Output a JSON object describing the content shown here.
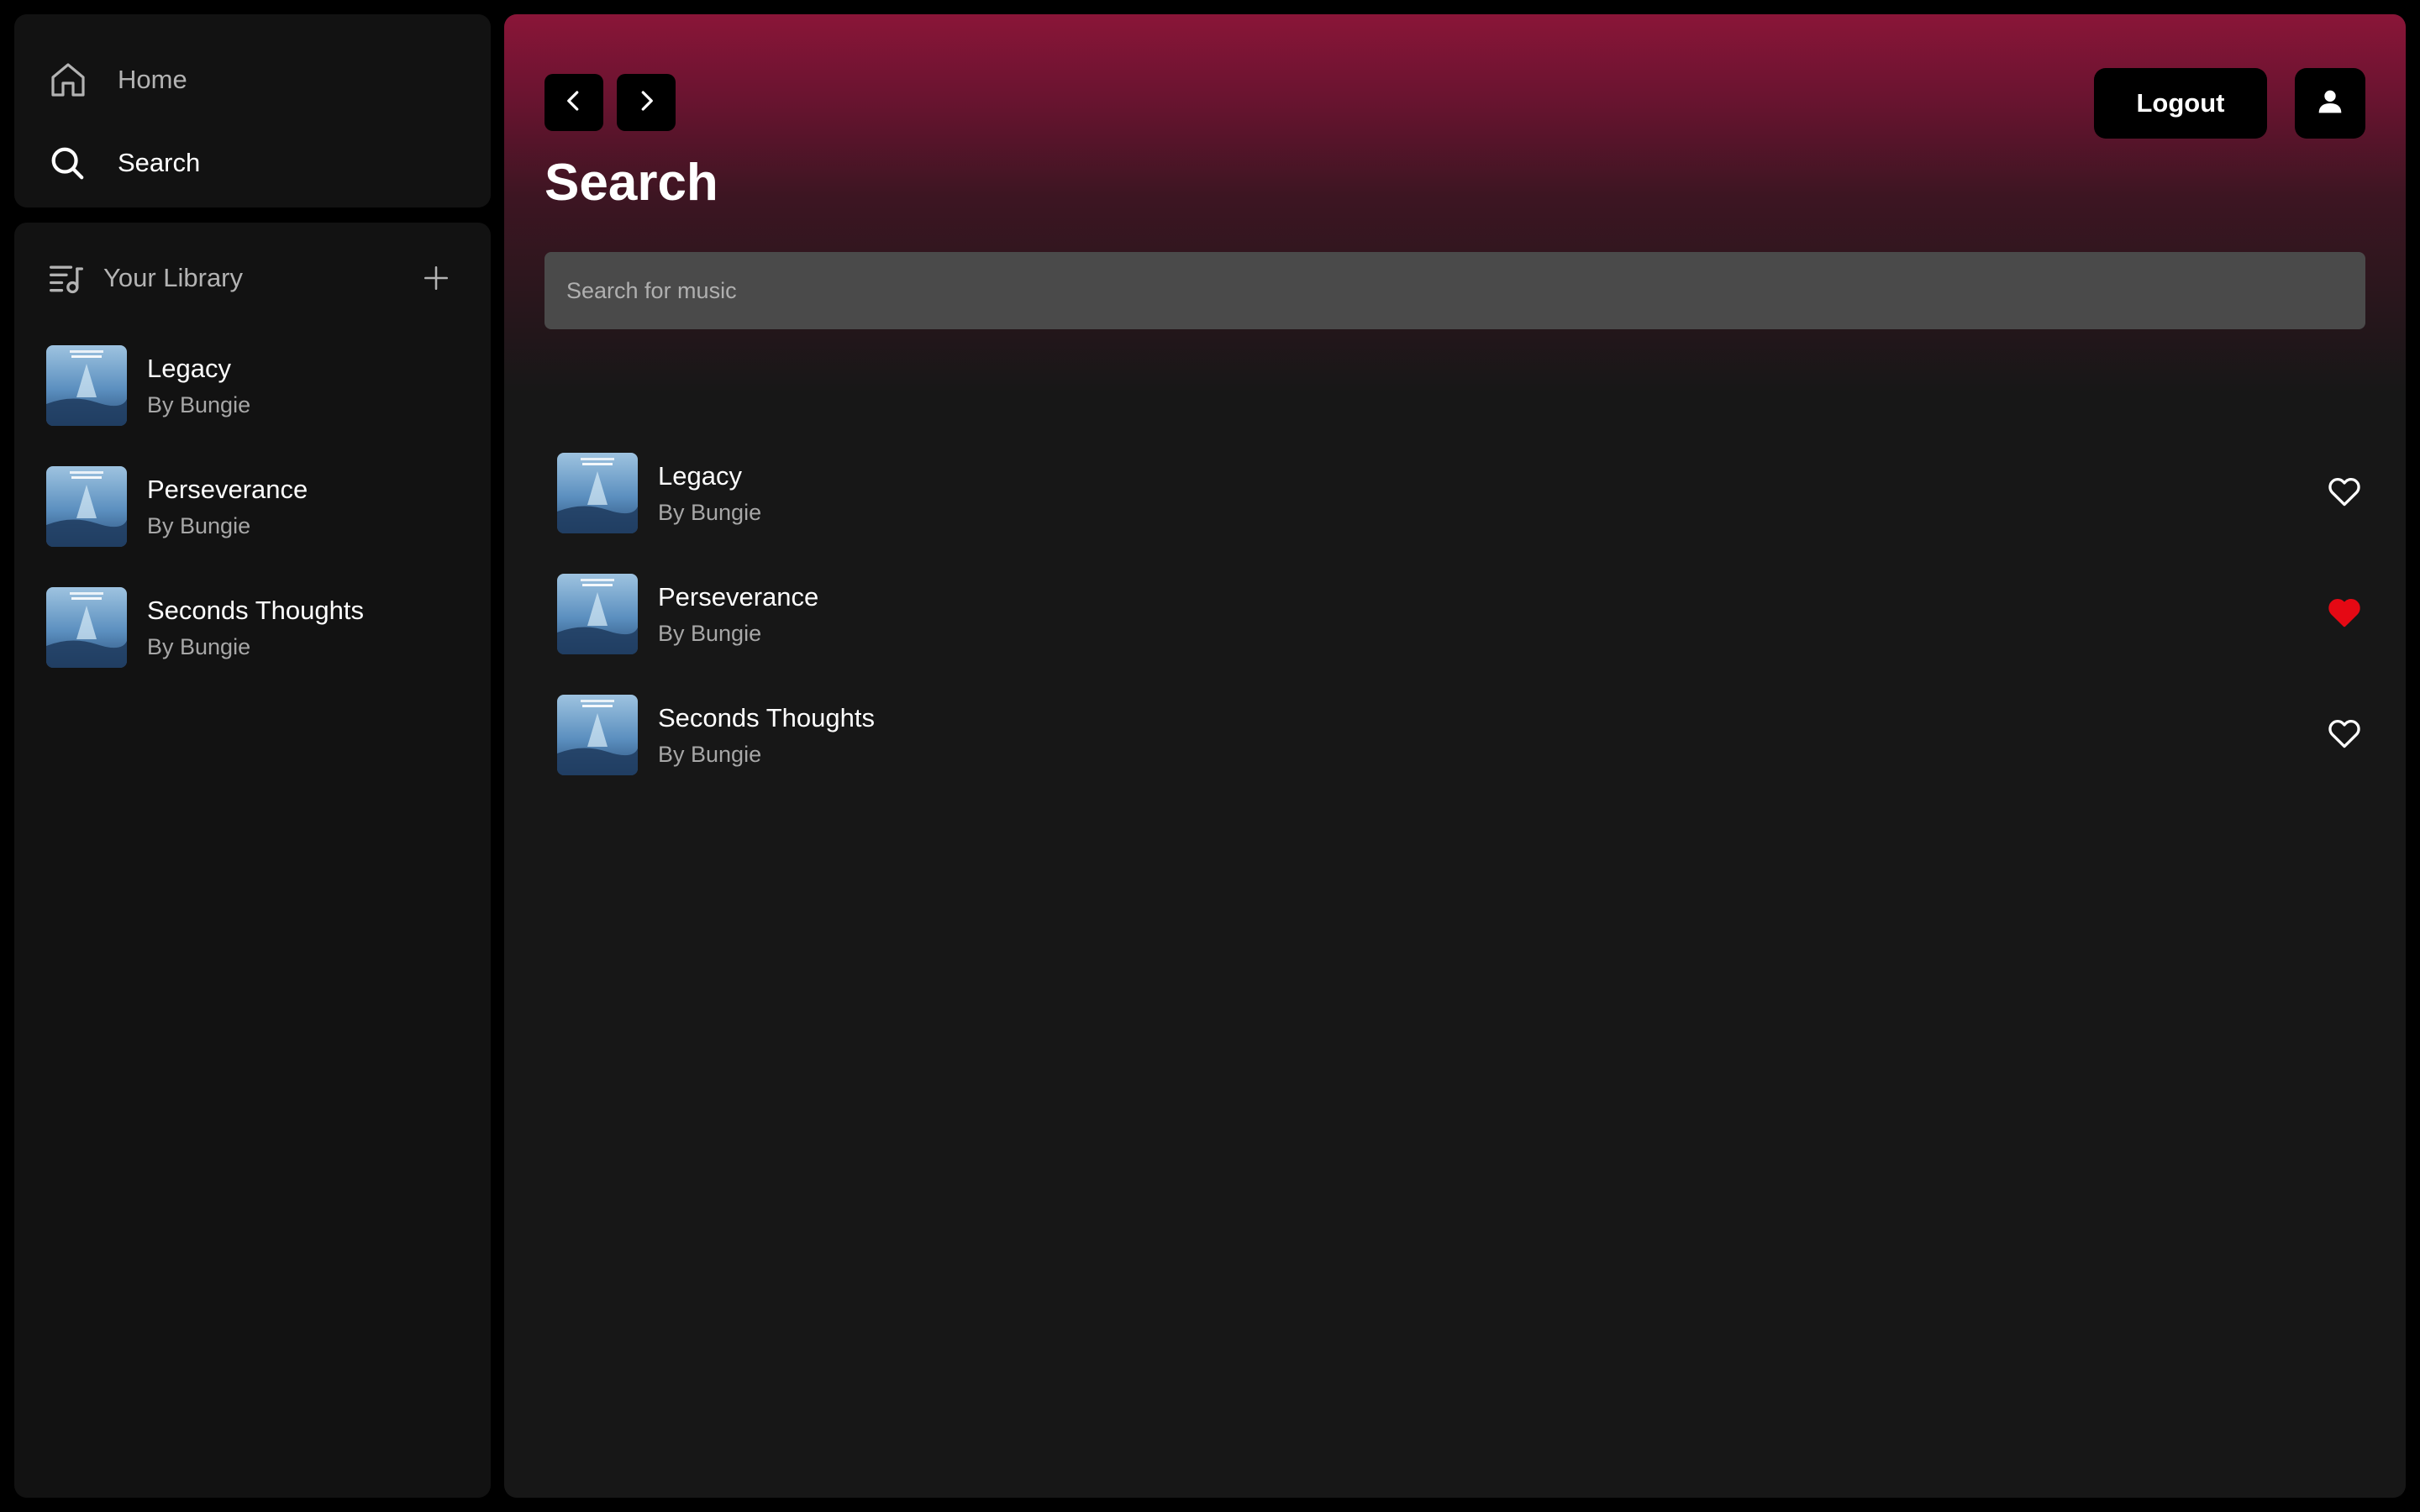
{
  "nav": {
    "home_label": "Home",
    "search_label": "Search"
  },
  "library": {
    "title": "Your Library",
    "items": [
      {
        "title": "Legacy",
        "artist": "By Bungie"
      },
      {
        "title": "Perseverance",
        "artist": "By Bungie"
      },
      {
        "title": "Seconds Thoughts",
        "artist": "By Bungie"
      }
    ]
  },
  "header": {
    "logout_label": "Logout"
  },
  "page": {
    "title": "Search"
  },
  "search": {
    "placeholder": "Search for music",
    "value": ""
  },
  "results": [
    {
      "title": "Legacy",
      "artist": "By Bungie",
      "liked": false
    },
    {
      "title": "Perseverance",
      "artist": "By Bungie",
      "liked": true
    },
    {
      "title": "Seconds Thoughts",
      "artist": "By Bungie",
      "liked": false
    }
  ],
  "colors": {
    "accent_gradient_top": "#8a1538",
    "liked_heart": "#e50914",
    "panel_bg": "#121212",
    "main_bg": "#171717"
  },
  "icons": {
    "home": "home-icon",
    "search": "search-icon",
    "library": "library-icon",
    "add": "plus-icon",
    "back": "chevron-left-icon",
    "forward": "chevron-right-icon",
    "user": "user-icon",
    "like": "heart-icon"
  }
}
